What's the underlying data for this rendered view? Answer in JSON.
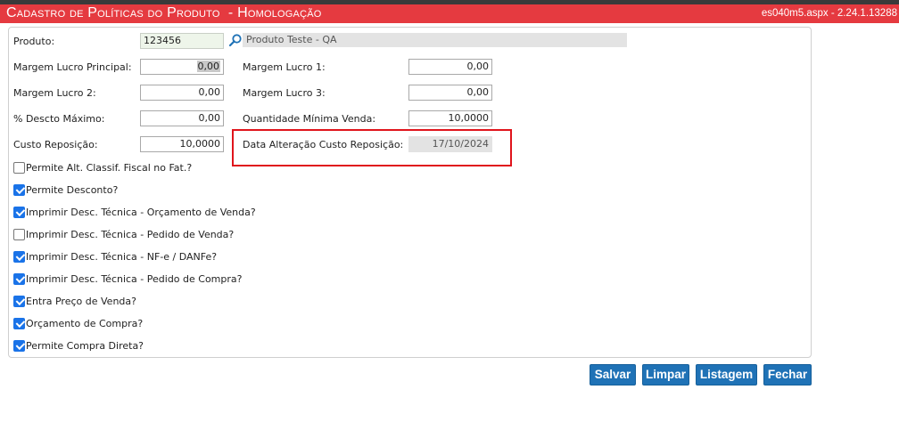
{
  "header": {
    "title": "Cadastro de Políticas do Produto  - Homologação",
    "version": "es040m5.aspx - 2.24.1.13288"
  },
  "form": {
    "produto": {
      "label": "Produto:",
      "code": "123456",
      "description": "Produto Teste - QA"
    },
    "margem_lucro_principal": {
      "label": "Margem Lucro Principal:",
      "value": "0,00"
    },
    "margem_lucro_1": {
      "label": "Margem Lucro 1:",
      "value": "0,00"
    },
    "margem_lucro_2": {
      "label": "Margem Lucro 2:",
      "value": "0,00"
    },
    "margem_lucro_3": {
      "label": "Margem Lucro 3:",
      "value": "0,00"
    },
    "desconto_maximo": {
      "label": "% Descto Máximo:",
      "value": "0,00"
    },
    "quantidade_minima_venda": {
      "label": "Quantidade Mínima Venda:",
      "value": "10,0000"
    },
    "custo_reposicao": {
      "label": "Custo Reposição:",
      "value": "10,0000"
    },
    "data_alteracao_custo": {
      "label": "Data Alteração Custo Reposição:",
      "value": "17/10/2024"
    }
  },
  "checkboxes": [
    {
      "label": "Permite Alt. Classif. Fiscal no Fat.?",
      "checked": false
    },
    {
      "label": "Permite Desconto?",
      "checked": true
    },
    {
      "label": "Imprimir Desc. Técnica - Orçamento de Venda?",
      "checked": true
    },
    {
      "label": "Imprimir Desc. Técnica - Pedido de Venda?",
      "checked": false
    },
    {
      "label": "Imprimir Desc. Técnica - NF-e / DANFe?",
      "checked": true
    },
    {
      "label": "Imprimir Desc. Técnica - Pedido de Compra?",
      "checked": true
    },
    {
      "label": "Entra Preço de Venda?",
      "checked": true
    },
    {
      "label": "Orçamento de Compra?",
      "checked": true
    },
    {
      "label": "Permite Compra Direta?",
      "checked": true
    }
  ],
  "buttons": {
    "salvar": "Salvar",
    "limpar": "Limpar",
    "listagem": "Listagem",
    "fechar": "Fechar"
  },
  "colors": {
    "title_bar": "#e53a40",
    "button": "#1f72b6",
    "checkbox_checked": "#1a73e8",
    "highlight_box": "#e0141c"
  }
}
